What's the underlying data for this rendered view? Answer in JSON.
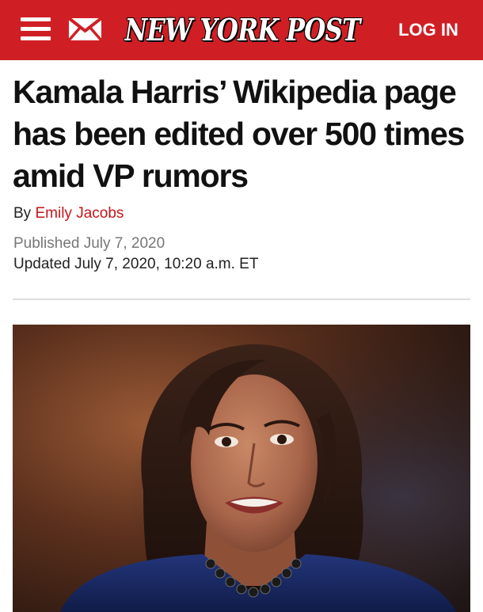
{
  "header": {
    "brand": "NEW YORK POST",
    "login_label": "LOG IN",
    "brand_color": "#cf1f25",
    "menu_icon": "hamburger-menu-icon",
    "mail_icon": "envelope-icon"
  },
  "article": {
    "headline": "Kamala Harris’ Wikipedia page has been edited over 500 times amid VP rumors",
    "byline_prefix": "By",
    "author": "Emily Jacobs",
    "published": "Published July 7, 2020",
    "updated": "Updated July 7, 2020, 10:20 a.m. ET",
    "accent_color": "#c4161c"
  }
}
